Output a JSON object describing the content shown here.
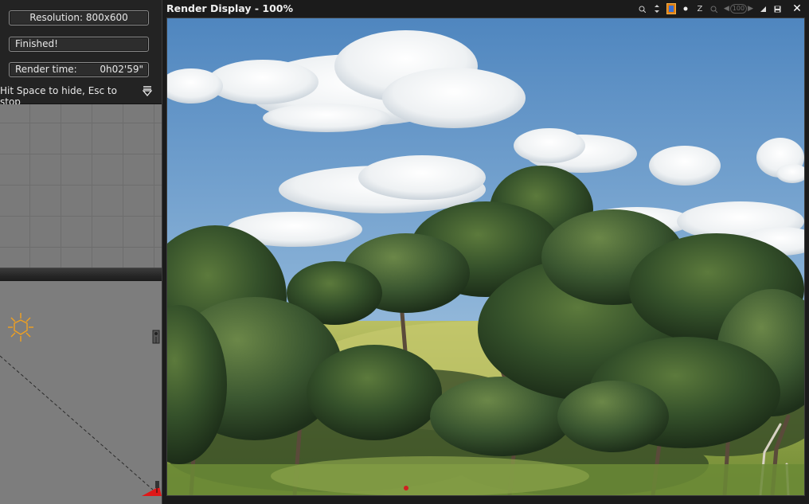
{
  "status": {
    "resolution": "Resolution: 800x600",
    "state": "Finished!",
    "render_time_label": "Render time:",
    "render_time_value": "0h02'59\"",
    "hint": "Hit Space to hide, Esc to stop"
  },
  "render_window": {
    "title": "Render Display - 100%",
    "toolbar_icons": [
      "zoom-in-icon",
      "pan-icon",
      "alpha-channel-icon",
      "dot-icon",
      "z-depth-icon",
      "zoom-fit-icon",
      "zoom-arrows-icon",
      "sharpen-icon",
      "save-icon",
      "close-icon"
    ],
    "zoom_value": "100",
    "z_label": "Z",
    "close_label": "✕"
  },
  "colors": {
    "accent_orange": "#e07f12",
    "panel_bg": "#232323",
    "viewport_bg": "#7b7b7b",
    "sky": "#5b90c4"
  }
}
